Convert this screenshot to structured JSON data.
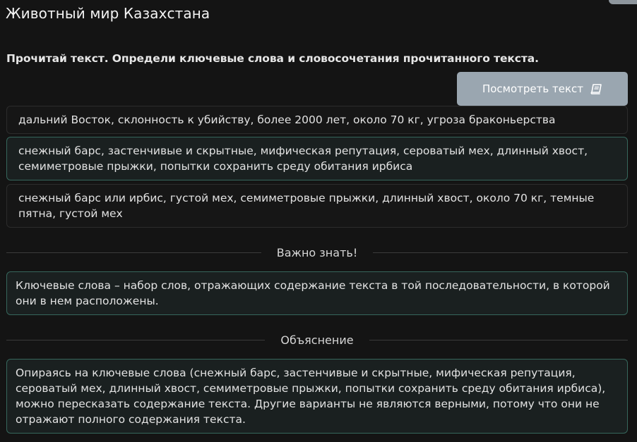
{
  "page": {
    "title": "Животный мир Казахстана",
    "task": "Прочитай текст. Определи ключевые слова и словосочетания прочитанного текста."
  },
  "view_button": {
    "label": "Посмотреть текст",
    "icon": "book-icon",
    "color": "#9aa6b0"
  },
  "options": [
    {
      "text": "дальний Восток, склонность к убийству, более 2000 лет, около 70 кг, угроза браконьерства",
      "selected": false
    },
    {
      "text": "снежный барс, застенчивые и скрытные, мифическая репутация, сероватый мех, длинный хвост, семиметровые прыжки, попытки сохранить среду обитания ирбиса",
      "selected": true
    },
    {
      "text": "снежный барс или ирбис, густой мех, семиметровые прыжки, длинный хвост, около 70 кг, темные пятна, густой мех",
      "selected": false
    }
  ],
  "important": {
    "heading": "Важно знать!",
    "text": "Ключевые слова – набор слов, отражающих содержание текста в той последовательности, в которой они в нем расположены."
  },
  "explanation": {
    "heading": "Объяснение",
    "text": "Опираясь на ключевые слова (снежный барс, застенчивые и скрытные, мифическая репутация, сероватый мех, длинный хвост, семиметровые прыжки, попытки сохранить среду обитания ирбиса), можно пересказать содержание текста. Другие варианты не являются верными, потому что они не отражают полного содержания текста."
  },
  "colors": {
    "accent_border": "#36675c",
    "background": "#141414"
  }
}
